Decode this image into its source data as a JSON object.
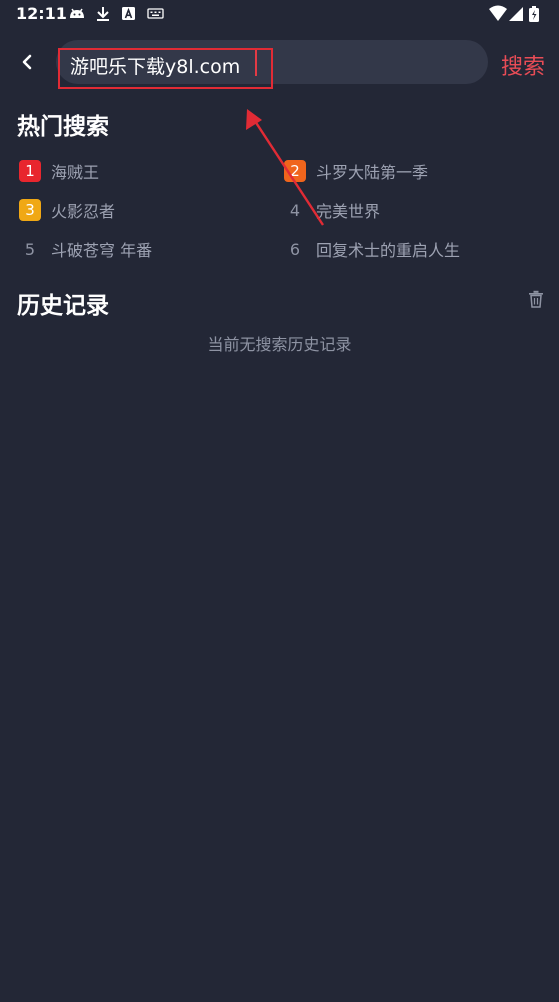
{
  "status": {
    "time": "12:11"
  },
  "search": {
    "query": "游吧乐下载y8l.com",
    "button_label": "搜索"
  },
  "hot": {
    "title": "热门搜索",
    "items": [
      {
        "rank": "1",
        "label": "海贼王",
        "badge_color": "#e8262e"
      },
      {
        "rank": "2",
        "label": "斗罗大陆第一季",
        "badge_color": "#f0651c"
      },
      {
        "rank": "3",
        "label": "火影忍者",
        "badge_color": "#f0a815"
      },
      {
        "rank": "4",
        "label": "完美世界"
      },
      {
        "rank": "5",
        "label": "斗破苍穹 年番"
      },
      {
        "rank": "6",
        "label": "回复术士的重启人生"
      }
    ]
  },
  "history": {
    "title": "历史记录",
    "empty_text": "当前无搜索历史记录"
  },
  "colors": {
    "background": "#232736",
    "accent": "#e84c56",
    "search_box": "#333849"
  }
}
